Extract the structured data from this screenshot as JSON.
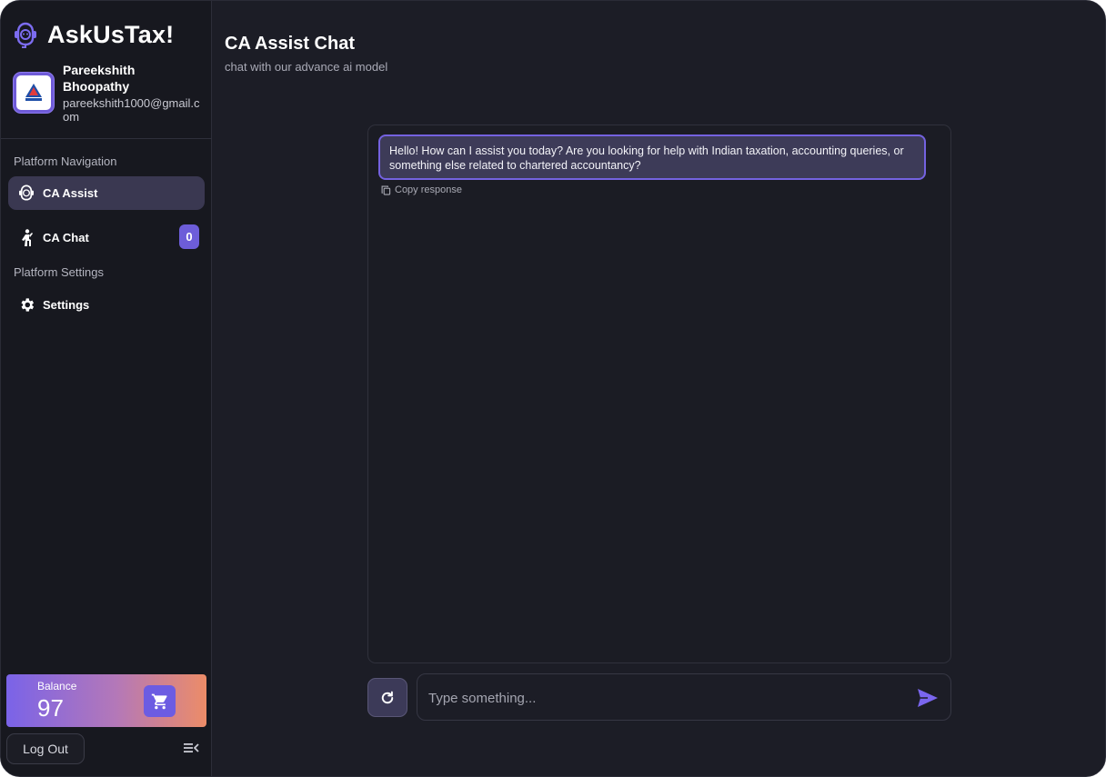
{
  "app": {
    "name": "AskUsTax!"
  },
  "user": {
    "first_name": "Pareekshith",
    "last_name": "Bhoopathy",
    "email": "pareekshith1000@gmail.com"
  },
  "sidebar": {
    "nav_section_label": "Platform Navigation",
    "settings_section_label": "Platform Settings",
    "items": [
      {
        "label": "CA Assist",
        "icon": "robot-head-icon",
        "active": true
      },
      {
        "label": "CA Chat",
        "icon": "person-walking-icon",
        "badge": "0"
      },
      {
        "label": "Settings",
        "icon": "gear-icon"
      }
    ]
  },
  "balance": {
    "label": "Balance",
    "value": "97",
    "icon": "cart-icon"
  },
  "logout": {
    "label": "Log Out"
  },
  "page": {
    "title": "CA Assist Chat",
    "subtitle": "chat with our advance ai model"
  },
  "chat": {
    "messages": [
      {
        "role": "assistant",
        "text": "Hello! How can I assist you today? Are you looking for help with Indian taxation, accounting queries, or something else related to chartered accountancy?"
      }
    ],
    "copy_label": "Copy response"
  },
  "composer": {
    "placeholder": "Type something...",
    "value": ""
  },
  "colors": {
    "accent": "#6d5dd9",
    "background": "#1c1d26",
    "sidebar": "#17181f",
    "bubble": "#3d3b58"
  }
}
